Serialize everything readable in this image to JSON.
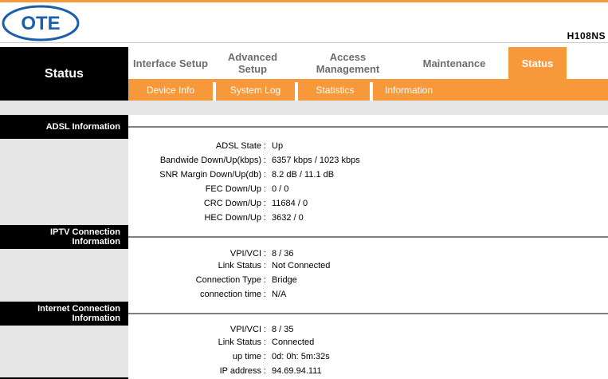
{
  "header": {
    "logo_text": "OTE",
    "model": "H108NS"
  },
  "section_title": "Status",
  "nav": [
    {
      "label": "Interface Setup"
    },
    {
      "label": "Advanced Setup"
    },
    {
      "label": "Access Management"
    },
    {
      "label": "Maintenance"
    },
    {
      "label": "Status",
      "active": true
    }
  ],
  "subnav": [
    {
      "label": "Device Info"
    },
    {
      "label": "System Log"
    },
    {
      "label": "Statistics"
    },
    {
      "label": "Information"
    }
  ],
  "adsl": {
    "title": "ADSL Information",
    "rows": [
      {
        "label": "ADSL State",
        "value": "Up"
      },
      {
        "label": "Bandwide Down/Up(kbps)",
        "value": "6357 kbps / 1023 kbps"
      },
      {
        "label": "SNR Margin Down/Up(db)",
        "value": "8.2 dB / 11.1 dB"
      },
      {
        "label": "FEC Down/Up",
        "value": "0 / 0"
      },
      {
        "label": "CRC Down/Up",
        "value": "11684 / 0"
      },
      {
        "label": "HEC Down/Up",
        "value": "3632 / 0"
      }
    ]
  },
  "iptv": {
    "title1": "IPTV Connection",
    "title2": "Information",
    "rows": [
      {
        "label": "VPI/VCI",
        "value": "8 / 36"
      },
      {
        "label": "Link Status",
        "value": "Not Connected"
      },
      {
        "label": "Connection Type",
        "value": "Bridge"
      },
      {
        "label": "connection time",
        "value": "N/A"
      }
    ]
  },
  "internet": {
    "title1": "Internet Connection",
    "title2": "Information",
    "rows": [
      {
        "label": "VPI/VCI",
        "value": "8 / 35"
      },
      {
        "label": "Link Status",
        "value": "Connected"
      },
      {
        "label": "up time",
        "value": "0d: 0h: 5m:32s"
      },
      {
        "label": "IP address",
        "value": "94.69.94.111"
      }
    ]
  },
  "colors": {
    "accent": "#f7993a",
    "logo": "#1b5faa"
  }
}
